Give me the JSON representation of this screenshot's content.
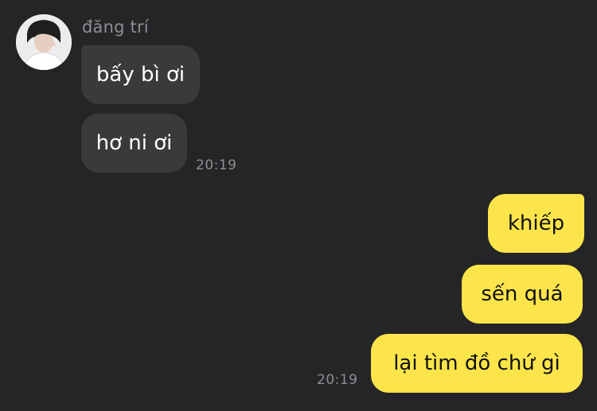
{
  "chat": {
    "sender_name": "đăng trí",
    "incoming": [
      {
        "text": "bấy bì ơi"
      },
      {
        "text": "hơ ni ơi"
      }
    ],
    "incoming_time": "20:19",
    "outgoing": [
      {
        "text": "khiếp"
      },
      {
        "text": "sến quá"
      },
      {
        "text": "lại tìm đồ chứ gì"
      }
    ],
    "outgoing_time": "20:19"
  },
  "colors": {
    "background": "#252527",
    "incoming_bubble": "#3a3a3c",
    "outgoing_bubble": "#fbe54a",
    "timestamp": "#8e8e93"
  },
  "icons": {
    "avatar": "avatar-photo"
  }
}
